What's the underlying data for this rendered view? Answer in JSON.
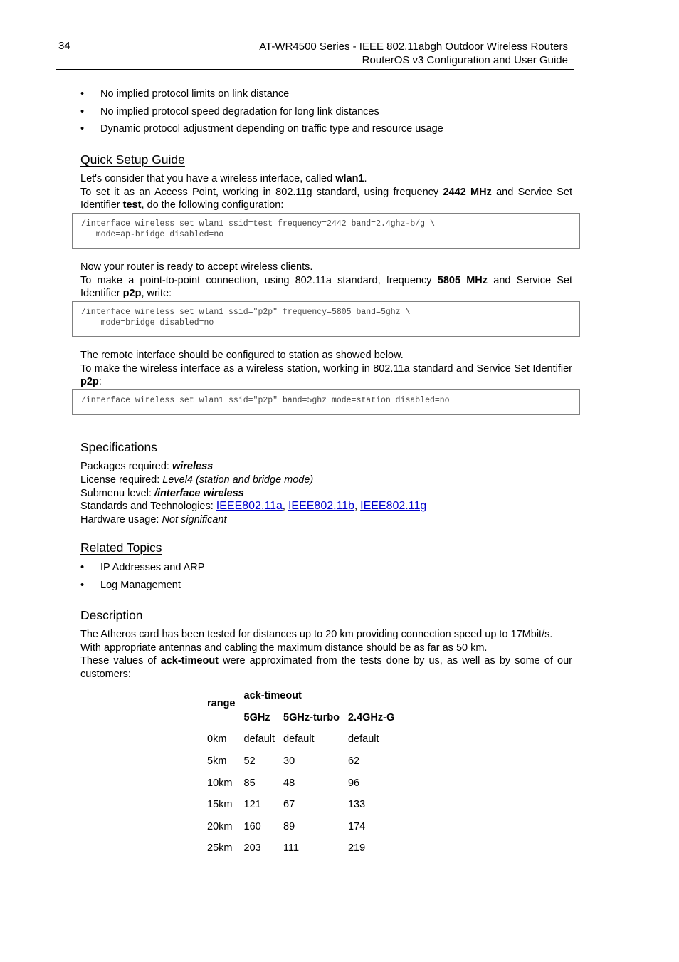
{
  "header": {
    "page_number": "34",
    "title_line1": "AT-WR4500 Series - IEEE 802.11abgh Outdoor Wireless Routers",
    "title_line2": "RouterOS v3 Configuration and User Guide"
  },
  "top_bullets": [
    "No implied protocol limits on link distance",
    "No implied protocol speed degradation for long link distances",
    "Dynamic protocol adjustment depending on traffic type and resource usage"
  ],
  "quick_setup": {
    "heading": "Quick Setup Guide",
    "intro1_pre": "Let's consider that you have a wireless interface, called ",
    "intro1_bold": "wlan1",
    "intro1_post": ".",
    "intro2_pre": "To set it as an Access Point, working in 802.11g standard, using frequency ",
    "intro2_bold1": "2442 MHz",
    "intro2_mid": " and Service Set Identifier ",
    "intro2_bold2": "test",
    "intro2_post": ", do the following configuration:",
    "code1": "/interface wireless set wlan1 ssid=test frequency=2442 band=2.4ghz-b/g \\\n   mode=ap-bridge disabled=no",
    "para2_line1": "Now your router is ready to accept wireless clients.",
    "para2_pre": "To make a point-to-point connection, using 802.11a standard, frequency ",
    "para2_bold1": "5805 MHz",
    "para2_mid": " and Service Set Identifier ",
    "para2_bold2": "p2p",
    "para2_post": ", write:",
    "code2": "/interface wireless set wlan1 ssid=\"p2p\" frequency=5805 band=5ghz \\\n    mode=bridge disabled=no",
    "para3_line1": "The remote interface should be configured to station as showed below.",
    "para3_pre": "To make the wireless interface as a wireless station, working in 802.11a standard and Service Set Identifier ",
    "para3_bold": "p2p",
    "para3_post": ":",
    "code3": "/interface wireless set wlan1 ssid=\"p2p\" band=5ghz mode=station disabled=no"
  },
  "specifications": {
    "heading": "Specifications",
    "packages_label": "Packages required: ",
    "packages_value": "wireless",
    "license_label": "License required: ",
    "license_value": "Level4 (station and bridge mode)",
    "submenu_label": "Submenu level: ",
    "submenu_value": "/interface wireless",
    "standards_label": "Standards and Technologies: ",
    "standards_links": [
      "IEEE802.11a",
      "IEEE802.11b",
      "IEEE802.11g"
    ],
    "standards_sep": ", ",
    "hardware_label": "Hardware usage: ",
    "hardware_value": "Not significant"
  },
  "related_topics": {
    "heading": "Related Topics",
    "items": [
      "IP Addresses and ARP",
      "Log Management"
    ]
  },
  "description": {
    "heading": "Description",
    "line1": "The Atheros card has been tested for distances up to 20 km providing connection speed up to 17Mbit/s.",
    "line2": "With appropriate antennas and cabling the maximum distance should be as far as 50 km.",
    "line3_pre": "These values of ",
    "line3_bold": "ack-timeout",
    "line3_post": " were approximated from the tests done by us, as well as by some of our customers:"
  },
  "ack_table": {
    "range_header": "range",
    "group_header": "ack-timeout",
    "columns": [
      "5GHz",
      "5GHz-turbo",
      "2.4GHz-G"
    ],
    "rows": [
      [
        "0km",
        "default",
        "default",
        "default"
      ],
      [
        "5km",
        "52",
        "30",
        "62"
      ],
      [
        "10km",
        "85",
        "48",
        "96"
      ],
      [
        "15km",
        "121",
        "67",
        "133"
      ],
      [
        "20km",
        "160",
        "89",
        "174"
      ],
      [
        "25km",
        "203",
        "111",
        "219"
      ]
    ]
  }
}
